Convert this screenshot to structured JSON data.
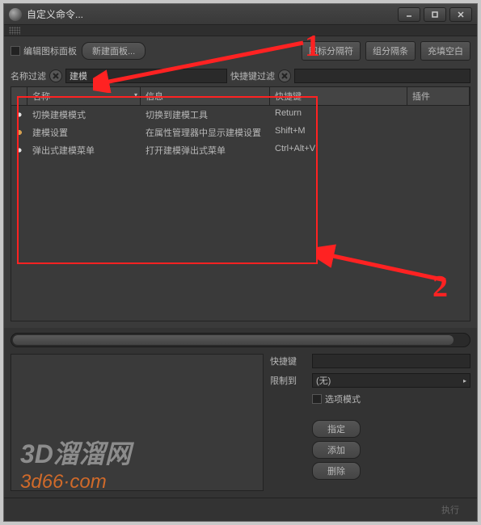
{
  "window": {
    "title": "自定义命令..."
  },
  "toolbar": {
    "edit_icon_panel": "编辑图标面板",
    "new_panel": "新建面板...",
    "icon_separator": "图标分隔符",
    "group_separator": "组分隔条",
    "fill_blank": "充填空白"
  },
  "filter": {
    "name_filter_label": "名称过滤",
    "name_filter_value": "建模",
    "shortcut_filter_label": "快捷键过滤"
  },
  "columns": {
    "name": "名称",
    "info": "信息",
    "shortcut": "快捷键",
    "plugin": "插件"
  },
  "rows": [
    {
      "icon": "dot",
      "name": "切换建模模式",
      "info": "切换到建模工具",
      "shortcut": "Return"
    },
    {
      "icon": "gear",
      "name": "建模设置",
      "info": "在属性管理器中显示建模设置",
      "shortcut": "Shift+M"
    },
    {
      "icon": "dot",
      "name": "弹出式建模菜单",
      "info": "打开建模弹出式菜单",
      "shortcut": "Ctrl+Alt+V"
    }
  ],
  "form": {
    "shortcut_label": "快捷键",
    "restrict_label": "限制到",
    "restrict_value": "(无)",
    "option_mode": "选项模式"
  },
  "buttons": {
    "assign": "指定",
    "add": "添加",
    "delete": "删除",
    "execute": "执行"
  },
  "watermark": {
    "line1": "3D溜溜网",
    "line2": "3d66·com"
  },
  "anno": {
    "one": "1",
    "two": "2"
  }
}
